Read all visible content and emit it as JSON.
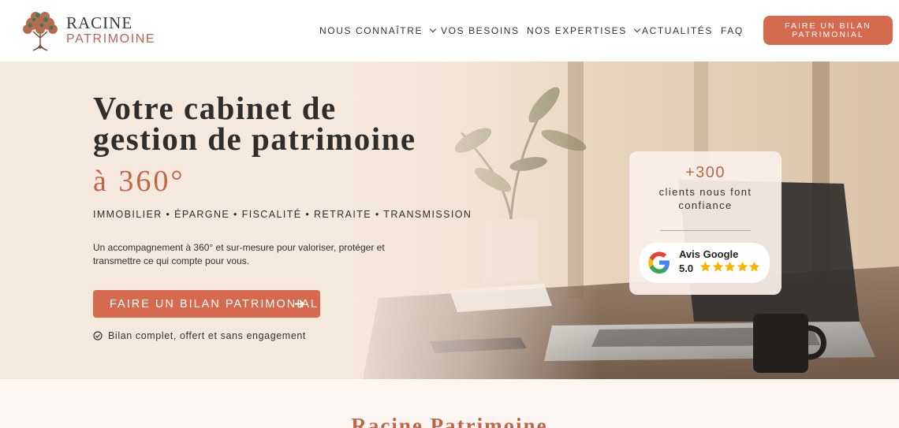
{
  "brand": {
    "name_line1": "RACINE",
    "name_line2": "PATRIMOINE"
  },
  "nav": {
    "items": [
      {
        "label": "NOUS CONNAÎTRE",
        "has_dropdown": true
      },
      {
        "label": "VOS BESOINS",
        "has_dropdown": false
      },
      {
        "label": "NOS EXPERTISES",
        "has_dropdown": true
      },
      {
        "label": "ACTUALITÉS",
        "has_dropdown": false
      },
      {
        "label": "FAQ",
        "has_dropdown": false
      }
    ],
    "cta_label": "FAIRE UN BILAN PATRIMONIAL"
  },
  "hero": {
    "title": "Votre cabinet de gestion de patrimoine",
    "accent": "à 360°",
    "tags": "IMMOBILIER • ÉPARGNE • FISCALITÉ • RETRAITE • TRANSMISSION",
    "description": "Un accompagnement à 360° et sur-mesure pour valoriser, protéger et transmettre ce qui compte pour vous.",
    "cta_label": "FAIRE UN BILAN PATRIMONIAL",
    "note": "Bilan complet, offert et sans engagement"
  },
  "trust": {
    "count": "+300",
    "text": "clients nous font confiance",
    "google_title": "Avis Google",
    "google_score": "5.0",
    "rating": 5
  },
  "next_section": {
    "title": "Racine Patrimoine"
  },
  "colors": {
    "accent": "#d66a4f",
    "accent_text": "#c0654a",
    "star": "#f4b400",
    "hero_bg": "#f4e5d8"
  },
  "icons": [
    "tree-logo-icon",
    "chevron-down-icon",
    "arrow-right-icon",
    "check-circle-icon",
    "google-g-icon",
    "star-icon"
  ]
}
